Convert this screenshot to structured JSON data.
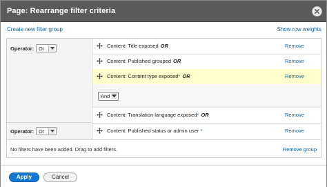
{
  "dialog": {
    "title": "Page: Rearrange filter criteria"
  },
  "links": {
    "create_group": "Create new filter group",
    "show_row_weights": "Show row weights"
  },
  "group1": {
    "operator_label": "Operator:",
    "operator_value": "Or",
    "rows": [
      {
        "text": "Content: Title exposed",
        "required": "",
        "op": "OR",
        "remove": "Remove",
        "highlighted": false
      },
      {
        "text": "Content: Published grouped",
        "required": "",
        "op": "OR",
        "remove": "Remove",
        "highlighted": false
      },
      {
        "text": "Content: Content type exposed",
        "required": "*",
        "op": "OR",
        "remove": "Remove",
        "highlighted": true
      }
    ],
    "and_value": "And",
    "after_rows": [
      {
        "text": "Content: Translation language exposed",
        "required": "*",
        "op": "OR",
        "remove": "Remove"
      }
    ]
  },
  "group2": {
    "operator_label": "Operator:",
    "operator_value": "Or",
    "rows": [
      {
        "text": "Content: Published status or admin user",
        "required": "*",
        "op": "",
        "remove": "Remove"
      }
    ],
    "empty_message": "No filters have been added. Drag to add filters.",
    "remove_group": "Remove group"
  },
  "buttons": {
    "apply": "Apply",
    "cancel": "Cancel"
  },
  "colors": {
    "titlebar": "#5b5b5b",
    "link": "#0f64a8",
    "highlight": "#ffffcc",
    "apply": "#1478d2"
  },
  "icons": {
    "close": "close-icon",
    "drag": "drag-handle-icon",
    "dropdown": "chevron-down-icon"
  }
}
